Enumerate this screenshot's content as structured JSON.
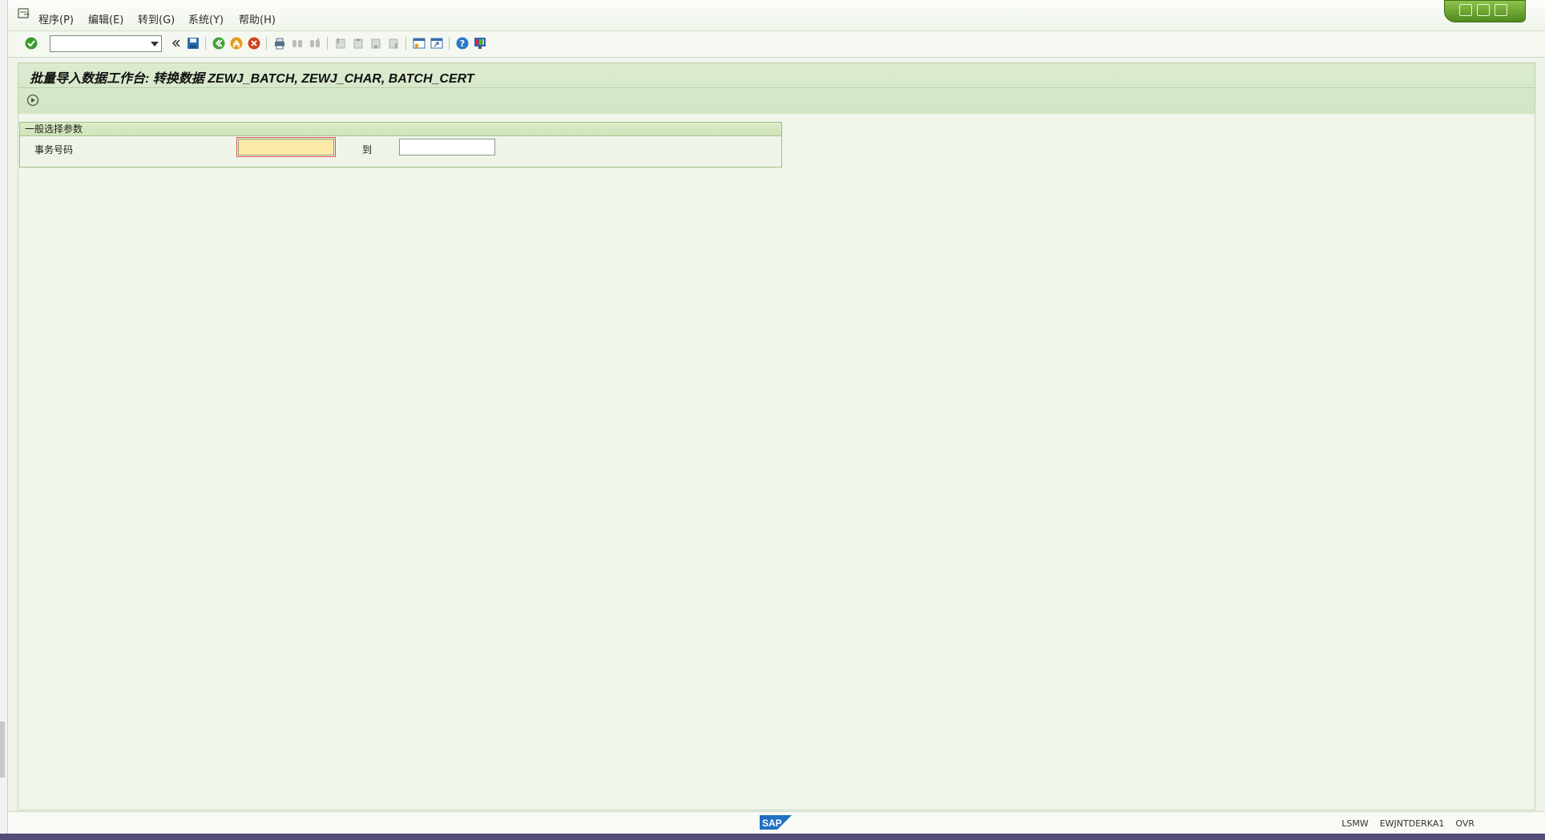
{
  "menubar": {
    "items": [
      {
        "label": "程序(P)"
      },
      {
        "label": "编辑(E)"
      },
      {
        "label": "转到(G)"
      },
      {
        "label": "系统(Y)"
      },
      {
        "label": "帮助(H)"
      }
    ]
  },
  "toolbar": {
    "command_value": "",
    "icons": [
      "enter-icon",
      "back-icon",
      "save-icon",
      "back-green-icon",
      "exit-icon",
      "cancel-icon",
      "print-icon",
      "find-icon",
      "find-next-icon",
      "first-page-icon",
      "previous-page-icon",
      "next-page-icon",
      "last-page-icon",
      "new-session-icon",
      "shortcut-icon",
      "help-icon",
      "layout-icon"
    ]
  },
  "page": {
    "title": "批量导入数据工作台: 转换数据 ZEWJ_BATCH, ZEWJ_CHAR, BATCH_CERT"
  },
  "selection": {
    "group_title": "一般选择参数",
    "field_label": "事务号码",
    "low_value": "",
    "to_label": "到",
    "high_value": ""
  },
  "statusbar": {
    "items": [
      "LSMW",
      "EWJNTDERKA1",
      "OVR"
    ]
  },
  "colors": {
    "accent_green": "#4f8a1c",
    "title_bg": "#d3e5c5",
    "required_field": "#fde9a8"
  }
}
